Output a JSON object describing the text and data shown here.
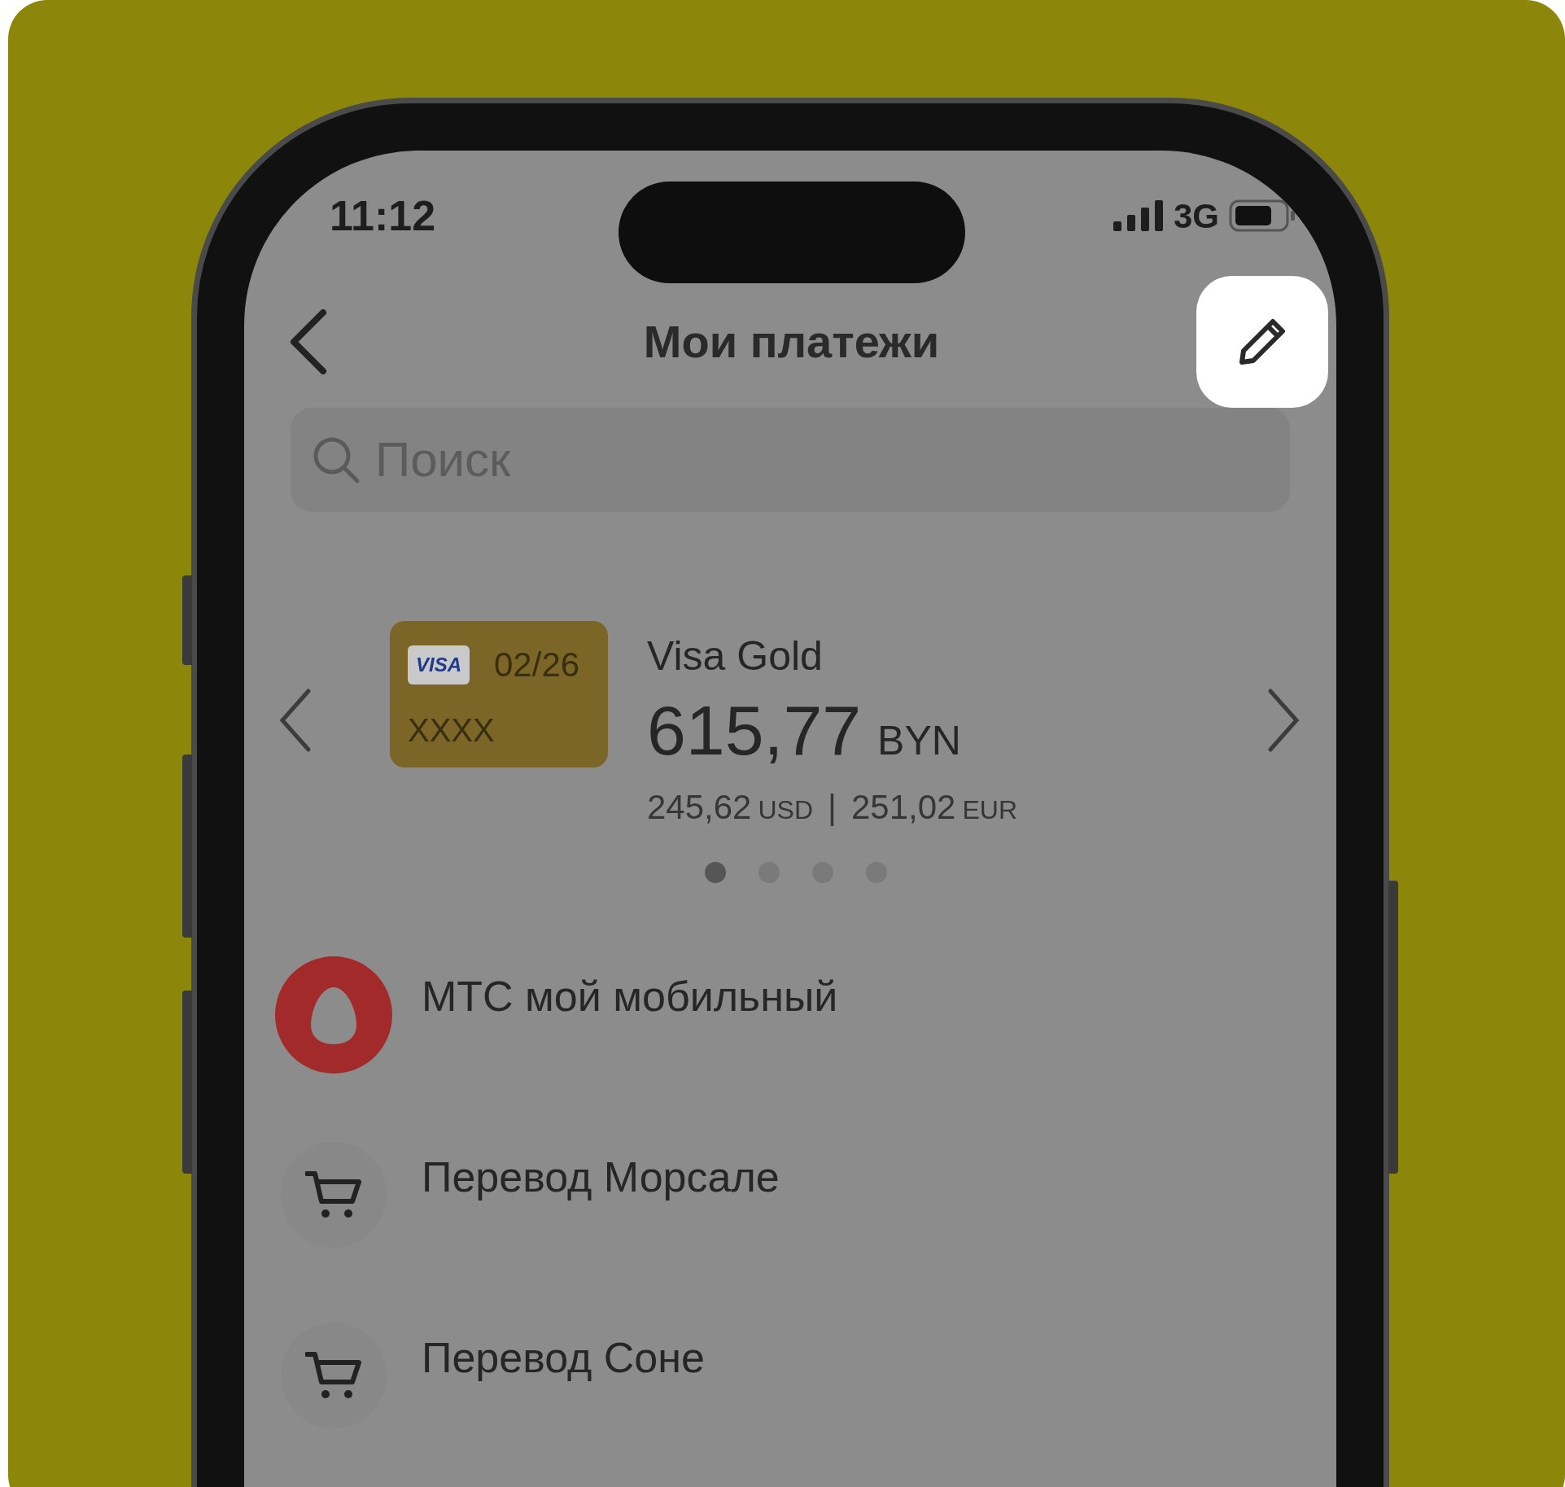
{
  "status_bar": {
    "time": "11:12",
    "network": "3G"
  },
  "header": {
    "title": "Мои платежи"
  },
  "search": {
    "placeholder": "Поиск"
  },
  "card": {
    "brand": "VISA",
    "expiry": "02/26",
    "number": "XXXX",
    "name": "Visa Gold",
    "amount": "615,77",
    "currency": "BYN",
    "usd_amount": "245,62",
    "usd_label": "USD",
    "separator": "|",
    "eur_amount": "251,02",
    "eur_label": "EUR"
  },
  "pager": [
    {
      "selected": true
    },
    {
      "selected": false
    },
    {
      "selected": false
    },
    {
      "selected": false
    }
  ],
  "payments": [
    {
      "kind": "operator",
      "title": "МТС мой мобильный",
      "color": "#a32a2a"
    },
    {
      "kind": "cart",
      "title": "Перевод Морсале"
    },
    {
      "kind": "cart",
      "title": "Перевод Соне"
    }
  ]
}
